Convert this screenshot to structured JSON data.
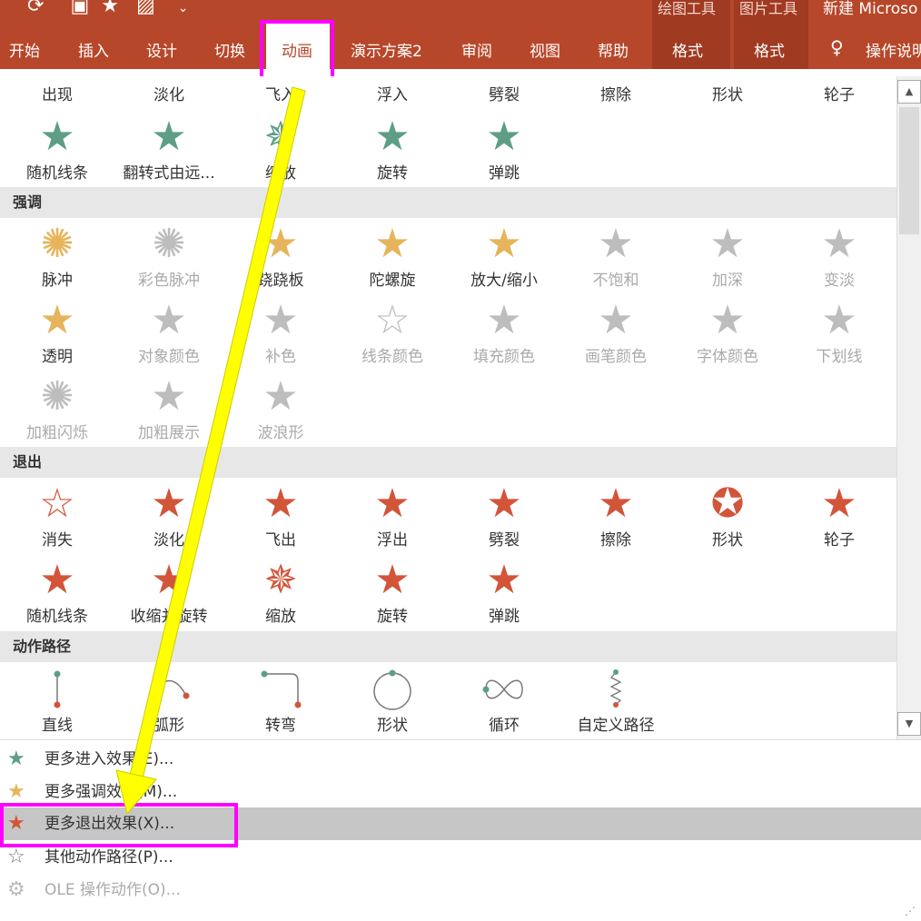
{
  "ribbon": {
    "title": "新建 Microso",
    "context_labels": [
      "绘图工具",
      "图片工具"
    ],
    "tabs": [
      "开始",
      "插入",
      "设计",
      "切换",
      "动画",
      "演示方案2",
      "审阅",
      "视图",
      "帮助",
      "格式",
      "格式"
    ],
    "tell_me": "操作说明"
  },
  "gallery": {
    "entrance_row0": [
      "出现",
      "淡化",
      "飞入",
      "浮入",
      "劈裂",
      "擦除",
      "形状",
      "轮子"
    ],
    "entrance_row1": [
      "随机线条",
      "翻转式由远...",
      "缩放",
      "旋转",
      "弹跳"
    ],
    "emphasis_title": "强调",
    "emphasis_row1": [
      "脉冲",
      "彩色脉冲",
      "跷跷板",
      "陀螺旋",
      "放大/缩小",
      "不饱和",
      "加深",
      "变淡"
    ],
    "emphasis_row2": [
      "透明",
      "对象颜色",
      "补色",
      "线条颜色",
      "填充颜色",
      "画笔颜色",
      "字体颜色",
      "下划线"
    ],
    "emphasis_row3": [
      "加粗闪烁",
      "加粗展示",
      "波浪形"
    ],
    "exit_title": "退出",
    "exit_row1": [
      "消失",
      "淡化",
      "飞出",
      "浮出",
      "劈裂",
      "擦除",
      "形状",
      "轮子"
    ],
    "exit_row2": [
      "随机线条",
      "收缩并旋转",
      "缩放",
      "旋转",
      "弹跳"
    ],
    "path_title": "动作路径",
    "path_row": [
      "直线",
      "弧形",
      "转弯",
      "形状",
      "循环",
      "自定义路径"
    ]
  },
  "menu": {
    "items": [
      "更多进入效果(E)...",
      "更多强调效果(M)...",
      "更多退出效果(X)...",
      "其他动作路径(P)...",
      "OLE 操作动作(O)..."
    ]
  },
  "colors": {
    "ribbon": "#b7472a",
    "entrance": "#5d9e85",
    "emphasis": "#e6b45a",
    "exit": "#d2553a",
    "highlight": "#ff00ff",
    "arrow": "#ffff00"
  }
}
